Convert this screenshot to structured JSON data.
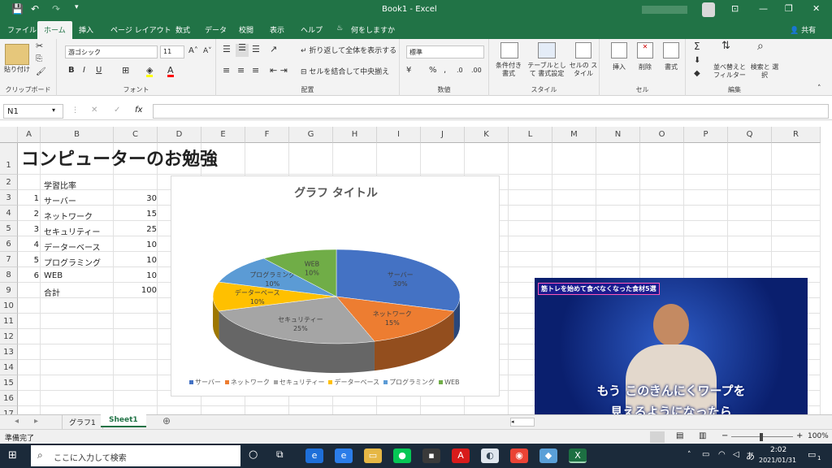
{
  "window": {
    "title": "Book1 - Excel",
    "share": "共有"
  },
  "ribbon_tabs": [
    "ファイル",
    "ホーム",
    "挿入",
    "ページ レイアウト",
    "数式",
    "データ",
    "校閲",
    "表示",
    "ヘルプ",
    "何をしますか"
  ],
  "ribbon": {
    "paste": "貼り付け",
    "clipboard": "クリップボード",
    "font_name": "游ゴシック",
    "font_size": "11",
    "font_group": "フォント",
    "wrap": "折り返して全体を表示する",
    "merge": "セルを結合して中央揃え",
    "align_group": "配置",
    "number_format": "標準",
    "number_group": "数値",
    "cond": "条件付き 書式",
    "table": "テーブルとして 書式設定",
    "cellstyle": "セルの スタイル",
    "style_group": "スタイル",
    "insert": "挿入",
    "delete": "削除",
    "format": "書式",
    "cells_group": "セル",
    "sort": "並べ替えと フィルター",
    "find": "検索と 選択",
    "edit_group": "編集"
  },
  "formula_bar": {
    "name_box": "N1",
    "fx": "fx",
    "value": ""
  },
  "columns": [
    "A",
    "B",
    "C",
    "D",
    "E",
    "F",
    "G",
    "H",
    "I",
    "J",
    "K",
    "L",
    "M",
    "N",
    "O",
    "P",
    "Q",
    "R"
  ],
  "rows": [
    "1",
    "2",
    "3",
    "4",
    "5",
    "6",
    "7",
    "8",
    "9",
    "10",
    "11",
    "12",
    "13",
    "14",
    "15",
    "16",
    "17"
  ],
  "sheet": {
    "title": "コンピューターのお勉強",
    "header": "学習比率",
    "items": [
      {
        "n": "1",
        "name": "サーバー",
        "v": "30"
      },
      {
        "n": "2",
        "name": "ネットワーク",
        "v": "15"
      },
      {
        "n": "3",
        "name": "セキュリティー",
        "v": "25"
      },
      {
        "n": "4",
        "name": "データーベース",
        "v": "10"
      },
      {
        "n": "5",
        "name": "プログラミング",
        "v": "10"
      },
      {
        "n": "6",
        "name": "WEB",
        "v": "10"
      }
    ],
    "total_label": "合計",
    "total": "100"
  },
  "chart_data": {
    "type": "pie",
    "title": "グラフ タイトル",
    "categories": [
      "サーバー",
      "ネットワーク",
      "セキュリティー",
      "データーベース",
      "プログラミング",
      "WEB"
    ],
    "values": [
      30,
      15,
      25,
      10,
      10,
      10
    ],
    "labels": [
      "30%",
      "15%",
      "25%",
      "10%",
      "10%",
      "10%"
    ],
    "colors": [
      "#4472c4",
      "#ed7d31",
      "#a5a5a5",
      "#ffc000",
      "#5b9bd5",
      "#70ad47"
    ],
    "legend": "bottom"
  },
  "sheet_tabs": [
    "グラフ1",
    "Sheet1"
  ],
  "status": {
    "ready": "準備完了",
    "zoom": "100%"
  },
  "video": {
    "banner": "筋トレを始めて食べなくなった食材5選",
    "line1": "もう このきんにくワープを",
    "line2": "見えるようになったら"
  },
  "taskbar": {
    "search": "ここに入力して検索",
    "time": "2:02",
    "date": "2021/01/31",
    "ime": "あ",
    "notify": "1"
  }
}
